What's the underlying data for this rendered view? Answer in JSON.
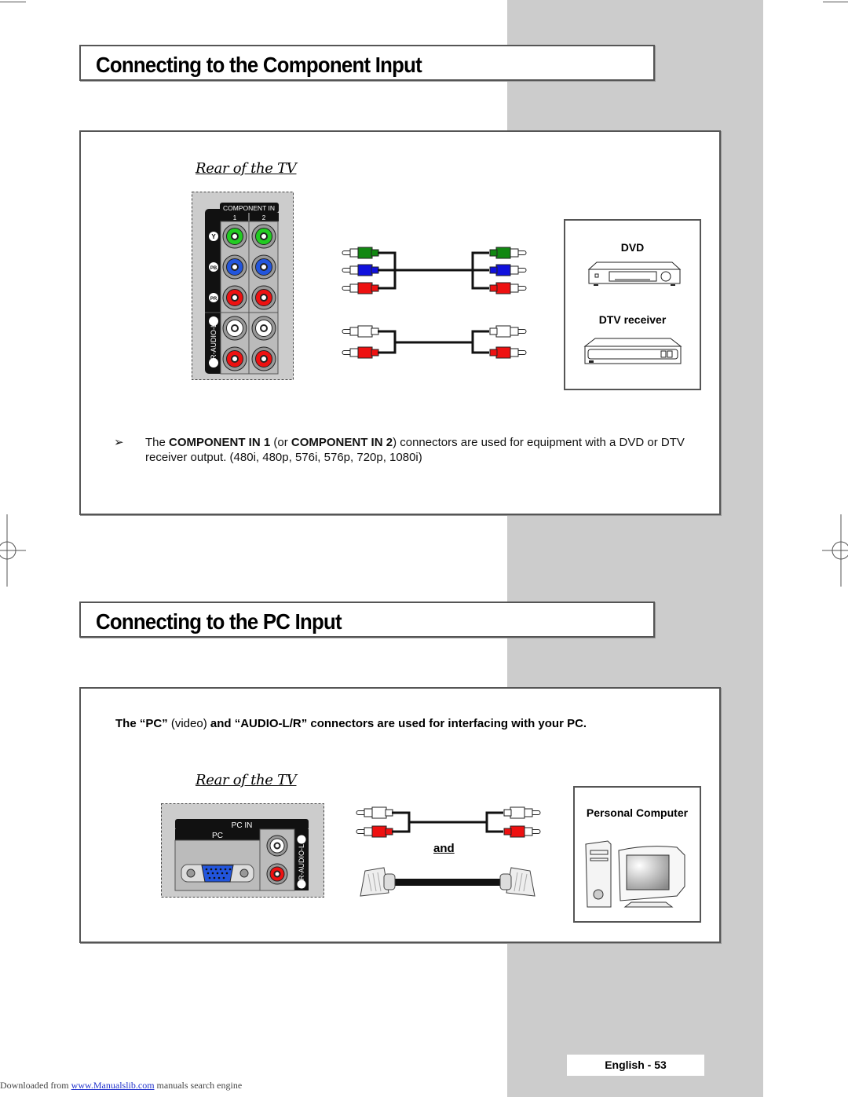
{
  "section1": {
    "title": "Connecting to the Component Input",
    "rear_label": "Rear of the TV",
    "panel": {
      "header": "COMPONENT IN",
      "columns": [
        "1",
        "2"
      ],
      "rows": [
        {
          "label": "Y",
          "color": "#22cc22"
        },
        {
          "label": "PB",
          "color": "#2255dd"
        },
        {
          "label": "PR",
          "color": "#ee1111"
        },
        {
          "label": "L",
          "color": "#ffffff"
        },
        {
          "label": "R",
          "color": "#ee1111"
        }
      ],
      "audio_label": "R-AUDIO-L"
    },
    "video_cable_colors": [
      "#118811",
      "#1111dd",
      "#ee1111"
    ],
    "audio_cable_colors": [
      "#ffffff",
      "#ee1111"
    ],
    "devices": [
      {
        "label": "DVD",
        "icon": "dvd-player-icon"
      },
      {
        "label": "DTV receiver",
        "icon": "dtv-receiver-icon"
      }
    ],
    "note": {
      "arrow": "➢",
      "parts": [
        {
          "text": "The ",
          "bold": false
        },
        {
          "text": "COMPONENT IN 1",
          "bold": true
        },
        {
          "text": " (or ",
          "bold": false
        },
        {
          "text": "COMPONENT IN 2",
          "bold": true
        },
        {
          "text": ") connectors are used for equipment with a DVD or DTV receiver output. (480i, 480p, 576i, 576p, 720p, 1080i)",
          "bold": false
        }
      ]
    }
  },
  "section2": {
    "title": "Connecting to the PC Input",
    "description": {
      "part1": "The “PC” ",
      "part2": "(video)",
      "part3": " and “AUDIO-L/R” connectors are used for interfacing with your PC."
    },
    "rear_label": "Rear of the TV",
    "panel": {
      "header": "PC IN",
      "sub_header": "PC",
      "audio_label": "R-AUDIO-L"
    },
    "audio_cable_colors": [
      "#ffffff",
      "#ee1111"
    ],
    "and_label": "and",
    "device": {
      "label": "Personal Computer",
      "icon": "personal-computer-icon"
    }
  },
  "footer": {
    "prefix": "Downloaded from ",
    "link": "www.Manualslib.com",
    "suffix": "  manuals search engine"
  },
  "page_number": "English - 53"
}
